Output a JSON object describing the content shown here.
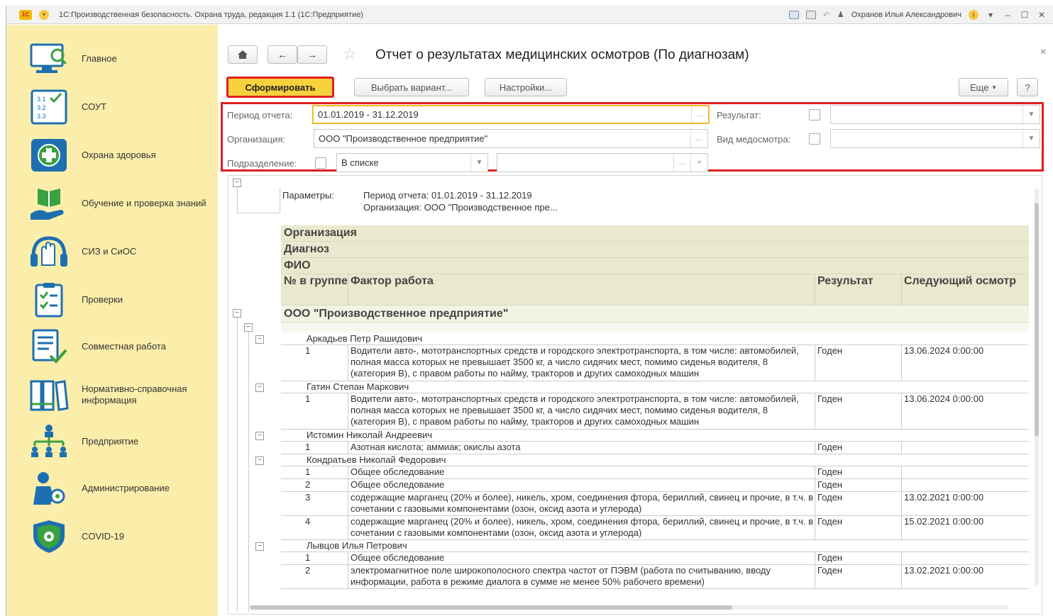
{
  "titlebar": {
    "logo": "1С",
    "title": "1С:Производственная безопасность. Охрана труда, редакция 1.1  (1С:Предприятие)",
    "user": "Охранов Илья Александрович"
  },
  "sidebar": {
    "items": [
      {
        "label": "Главное",
        "icon": "monitor-icon"
      },
      {
        "label": "СОУТ",
        "icon": "checklist-icon"
      },
      {
        "label": "Охрана здоровья",
        "icon": "medical-cross-icon"
      },
      {
        "label": "Обучение и проверка знаний",
        "icon": "book-hand-icon"
      },
      {
        "label": "СИЗ и СиОС",
        "icon": "gloves-icon"
      },
      {
        "label": "Проверки",
        "icon": "clipboard-icon"
      },
      {
        "label": "Совместная работа",
        "icon": "document-check-icon"
      },
      {
        "label": "Нормативно-справочная информация",
        "icon": "binders-icon"
      },
      {
        "label": "Предприятие",
        "icon": "org-structure-icon"
      },
      {
        "label": "Администрирование",
        "icon": "user-gear-icon"
      },
      {
        "label": "COVID-19",
        "icon": "shield-virus-icon"
      }
    ]
  },
  "header": {
    "title": "Отчет о результатах медицинских осмотров (По диагнозам)"
  },
  "toolbar": {
    "generate": "Сформировать",
    "choose_variant": "Выбрать вариант...",
    "settings": "Настройки...",
    "more": "Еще",
    "help": "?"
  },
  "params": {
    "period_label": "Период отчета:",
    "period_value": "01.01.2019 - 31.12.2019",
    "org_label": "Организация:",
    "org_value": "ООО \"Производственное предприятие\"",
    "dept_label": "Подразделение:",
    "dept_mode": "В списке",
    "result_label": "Результат:",
    "exam_type_label": "Вид медосмотра:"
  },
  "report": {
    "params_label": "Параметры:",
    "params_line1": "Период отчета: 01.01.2019 - 31.12.2019",
    "params_line2": "Организация: ООО \"Производственное пре...",
    "group_headers": [
      "Организация",
      "Диагноз",
      "ФИО"
    ],
    "columns": [
      "№ в группе",
      "Фактор работа",
      "Результат",
      "Следующий осмотр"
    ],
    "org_row": "ООО \"Производственное предприятие\"",
    "persons": [
      {
        "name": "Аркадьев Петр Рашидович",
        "rows": [
          {
            "num": "1",
            "factor": "Водители авто-, мототранспортных средств и городского электротранспорта, в том числе: автомобилей, полная масса которых не превышает 3500 кг, а число сидячих мест, помимо сиденья водителя, 8 (категория В), с правом работы по найму, тракторов и других самоходных машин",
            "result": "Годен",
            "next": "13.06.2024 0:00:00"
          }
        ]
      },
      {
        "name": "Гатин Степан Маркович",
        "rows": [
          {
            "num": "1",
            "factor": "Водители авто-, мототранспортных средств и городского электротранспорта, в том числе: автомобилей, полная масса которых не превышает 3500 кг, а число сидячих мест, помимо сиденья водителя, 8 (категория В), с правом работы по найму, тракторов и других самоходных машин",
            "result": "Годен",
            "next": "13.06.2024 0:00:00"
          }
        ]
      },
      {
        "name": "Истомин Николай Андреевич",
        "rows": [
          {
            "num": "1",
            "factor": "Азотная кислота; аммиак; окислы азота",
            "result": "Годен",
            "next": ""
          }
        ]
      },
      {
        "name": "Кондратьев Николай Федорович",
        "rows": [
          {
            "num": "1",
            "factor": "Общее обследование",
            "result": "Годен",
            "next": ""
          },
          {
            "num": "2",
            "factor": "Общее обследование",
            "result": "Годен",
            "next": ""
          },
          {
            "num": "3",
            "factor": "содержащие марганец (20% и более), никель, хром, соединения фтора, бериллий, свинец и прочие, в т.ч. в сочетании с газовыми компонентами (озон, оксид азота и углерода)",
            "result": "Годен",
            "next": "13.02.2021 0:00:00"
          },
          {
            "num": "4",
            "factor": "содержащие марганец (20% и более), никель, хром, соединения фтора, бериллий, свинец и прочие, в т.ч. в сочетании с газовыми компонентами (озон, оксид азота и углерода)",
            "result": "Годен",
            "next": "15.02.2021 0:00:00"
          }
        ]
      },
      {
        "name": "Лывцов Илья Петрович",
        "rows": [
          {
            "num": "1",
            "factor": "Общее обследование",
            "result": "Годен",
            "next": ""
          },
          {
            "num": "2",
            "factor": "электромагнитное поле широкополосного спектра частот от ПЭВМ (работа по считыванию, вводу информации, работа в режиме диалога в сумме не менее 50% рабочего времени)",
            "result": "Годен",
            "next": "13.02.2021 0:00:00"
          }
        ]
      }
    ]
  },
  "colors": {
    "sidebar_bg": "#fbeeaa",
    "primary_button": "#f6d23d",
    "highlight_border": "#dd2020",
    "report_header_bg": "#e9e9cf"
  }
}
